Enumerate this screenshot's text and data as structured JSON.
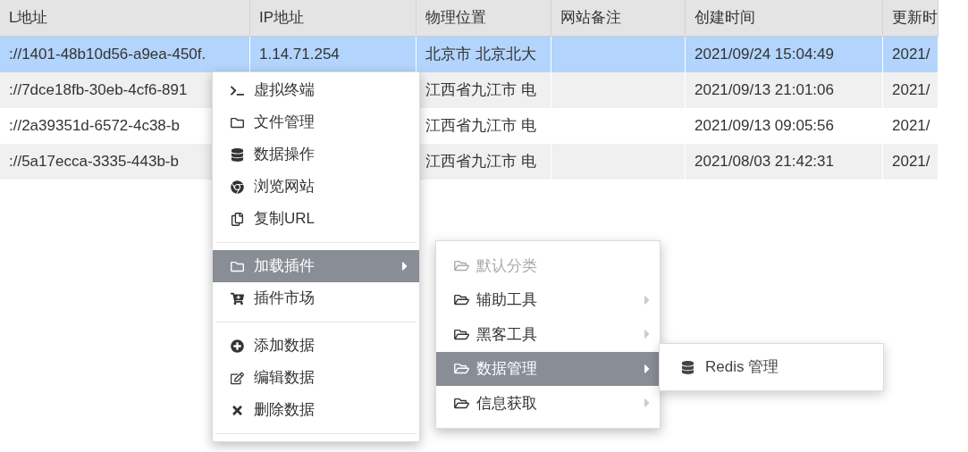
{
  "table": {
    "columns": [
      "L地址",
      "IP地址",
      "物理位置",
      "网站备注",
      "创建时间",
      "更新时"
    ],
    "rows": [
      {
        "selected": true,
        "cells": [
          "://1401-48b10d56-a9ea-450f.",
          "1.14.71.254",
          "北京市 北京北大",
          "",
          "2021/09/24 15:04:49",
          "2021/"
        ]
      },
      {
        "selected": false,
        "cells": [
          "://7dce18fb-30eb-4cf6-891",
          "",
          "江西省九江市 电",
          "",
          "2021/09/13 21:01:06",
          "2021/"
        ]
      },
      {
        "selected": false,
        "cells": [
          "://2a39351d-6572-4c38-b",
          "",
          "江西省九江市 电",
          "",
          "2021/09/13 09:05:56",
          "2021/"
        ]
      },
      {
        "selected": false,
        "cells": [
          "://5a17ecca-3335-443b-b",
          "",
          "江西省九江市 电",
          "",
          "2021/08/03 21:42:31",
          "2021/"
        ]
      }
    ]
  },
  "context_menu": {
    "items": [
      {
        "kind": "item",
        "label": "虚拟终端",
        "selected": false,
        "has_submenu": false
      },
      {
        "kind": "item",
        "label": "文件管理",
        "selected": false,
        "has_submenu": false
      },
      {
        "kind": "item",
        "label": "数据操作",
        "selected": false,
        "has_submenu": false
      },
      {
        "kind": "item",
        "label": "浏览网站",
        "selected": false,
        "has_submenu": false
      },
      {
        "kind": "item",
        "label": "复制URL",
        "selected": false,
        "has_submenu": false
      },
      {
        "kind": "separator"
      },
      {
        "kind": "item",
        "label": "加载插件",
        "selected": true,
        "has_submenu": true
      },
      {
        "kind": "item",
        "label": "插件市场",
        "selected": false,
        "has_submenu": false
      },
      {
        "kind": "separator"
      },
      {
        "kind": "item",
        "label": "添加数据",
        "selected": false,
        "has_submenu": false
      },
      {
        "kind": "item",
        "label": "编辑数据",
        "selected": false,
        "has_submenu": false
      },
      {
        "kind": "item",
        "label": "删除数据",
        "selected": false,
        "has_submenu": false
      },
      {
        "kind": "separator"
      }
    ]
  },
  "plugin_submenu": {
    "items": [
      {
        "label": "默认分类",
        "disabled": true,
        "selected": false,
        "has_submenu": false
      },
      {
        "label": "辅助工具",
        "disabled": false,
        "selected": false,
        "has_submenu": true
      },
      {
        "label": "黑客工具",
        "disabled": false,
        "selected": false,
        "has_submenu": true
      },
      {
        "label": "数据管理",
        "disabled": false,
        "selected": true,
        "has_submenu": true
      },
      {
        "label": "信息获取",
        "disabled": false,
        "selected": false,
        "has_submenu": true
      }
    ]
  },
  "data_submenu": {
    "items": [
      {
        "label": "Redis 管理"
      }
    ]
  }
}
